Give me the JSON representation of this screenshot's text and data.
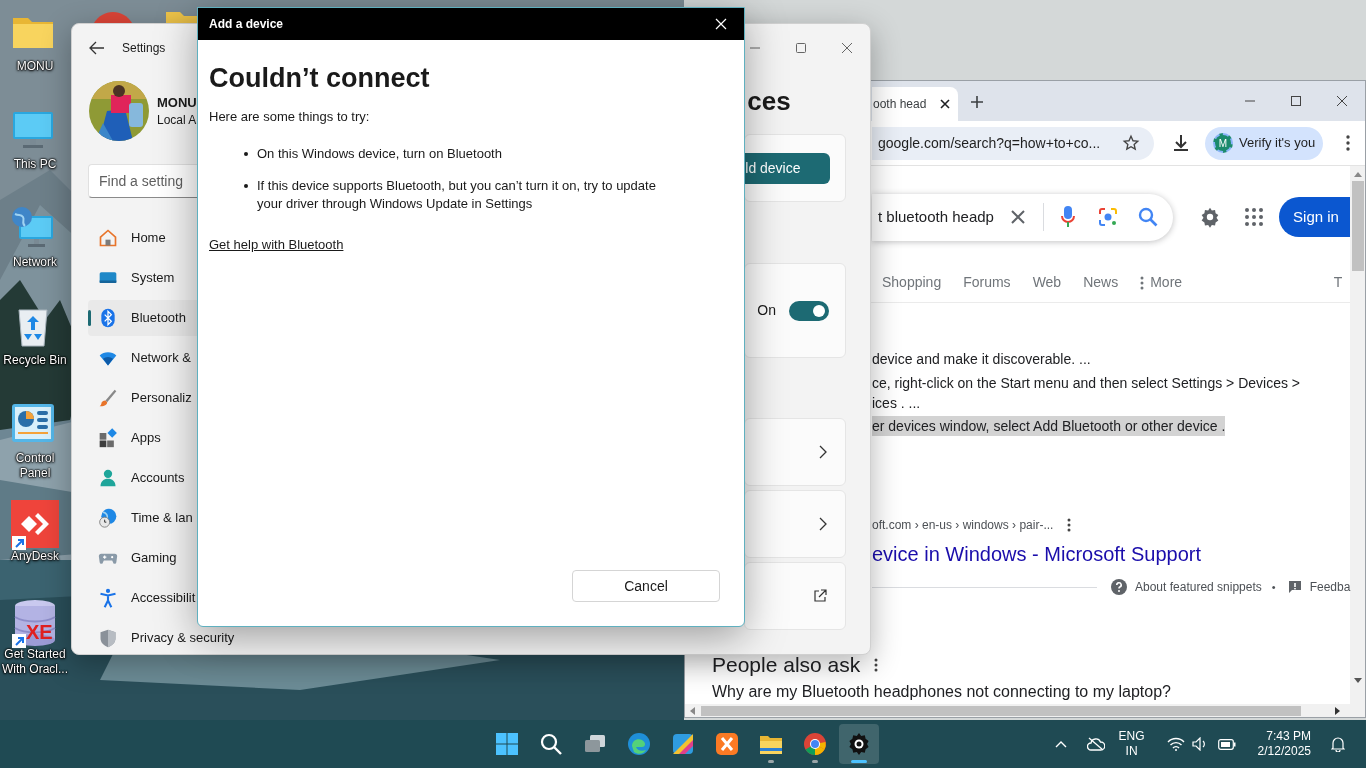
{
  "desktop_icons": [
    {
      "label": "MONU",
      "kind": "folder",
      "shortcut": false
    },
    {
      "label": "This PC",
      "kind": "pc",
      "shortcut": false
    },
    {
      "label": "Network",
      "kind": "network",
      "shortcut": false
    },
    {
      "label": "Recycle Bin",
      "kind": "recycle",
      "shortcut": false
    },
    {
      "label": "Control Panel",
      "kind": "control",
      "shortcut": false
    },
    {
      "label": "AnyDesk",
      "kind": "anydesk",
      "shortcut": true
    },
    {
      "label": "Get Started With Oracl...",
      "kind": "database",
      "shortcut": true,
      "badge": "XE"
    }
  ],
  "browser": {
    "tab_title": "ooth head",
    "address": "google.com/search?q=how+to+co...",
    "profile_button": "Verify it's you",
    "avatar_letter": "M",
    "search_query": "t bluetooth headp",
    "sign_in": "Sign in",
    "tabs": [
      {
        "label": "Shopping",
        "kind": "plain"
      },
      {
        "label": "Forums",
        "kind": "plain"
      },
      {
        "label": "Web",
        "kind": "plain"
      },
      {
        "label": "News",
        "kind": "plain"
      },
      {
        "label": "More",
        "kind": "menu"
      },
      {
        "label": "T",
        "kind": "edge"
      }
    ],
    "snippet_lines": [
      {
        "text": "device and make it discoverable. ...",
        "highlighted": false
      },
      {
        "text": "ce, right-click on the Start menu and then select Settings > Devices >",
        "highlighted": false
      },
      {
        "text": "ices . ...",
        "highlighted": false
      },
      {
        "text": "er devices window, select Add Bluetooth or other device .",
        "highlighted": true
      }
    ],
    "source": "oft.com › en-us › windows › pair-...",
    "result_title": "evice in Windows - Microsoft Support",
    "about_snippets": "About featured snippets",
    "separator": "•",
    "feedback": "Feedba",
    "people_also_ask": "People also ask",
    "question": "Why are my Bluetooth headphones not connecting to my laptop?"
  },
  "settings": {
    "title": "Settings",
    "user_name": "MONU",
    "account_type": "Local A",
    "search_placeholder": "Find a setting",
    "nav": [
      {
        "label": "Home",
        "kind": "home",
        "selected": false
      },
      {
        "label": "System",
        "kind": "system",
        "selected": false
      },
      {
        "label": "Bluetooth",
        "kind": "bluetooth",
        "selected": true
      },
      {
        "label": "Network &",
        "kind": "network",
        "selected": false
      },
      {
        "label": "Personaliz",
        "kind": "brush",
        "selected": false
      },
      {
        "label": "Apps",
        "kind": "apps",
        "selected": false
      },
      {
        "label": "Accounts",
        "kind": "accounts",
        "selected": false
      },
      {
        "label": "Time & lan",
        "kind": "time",
        "selected": false
      },
      {
        "label": "Gaming",
        "kind": "gaming",
        "selected": false
      },
      {
        "label": "Accessibilit",
        "kind": "accessibility",
        "selected": false
      },
      {
        "label": "Privacy & security",
        "kind": "privacy",
        "selected": false
      }
    ],
    "heading": "ces",
    "add_button": "ld device",
    "toggle_label": "On",
    "toggle_on": true,
    "cards": [
      {
        "kind": "chevron"
      },
      {
        "kind": "chevron"
      },
      {
        "kind": "external"
      }
    ]
  },
  "dialog": {
    "title": "Add a device",
    "heading": "Couldn’t connect",
    "intro": "Here are some things to try:",
    "tips": [
      "On this Windows device, turn on Bluetooth",
      "If this device supports Bluetooth, but you can’t turn it on, try to update your driver through Windows Update in Settings"
    ],
    "link": "Get help with Bluetooth",
    "cancel": "Cancel"
  },
  "taskbar": {
    "apps": [
      {
        "kind": "start",
        "running": false,
        "selected": false
      },
      {
        "kind": "search",
        "running": false,
        "selected": false
      },
      {
        "kind": "taskview",
        "running": false,
        "selected": false
      },
      {
        "kind": "edge",
        "running": false,
        "selected": false
      },
      {
        "kind": "copilot",
        "running": false,
        "selected": false
      },
      {
        "kind": "xampp",
        "running": false,
        "selected": false
      },
      {
        "kind": "explorer",
        "running": true,
        "selected": false
      },
      {
        "kind": "chrome",
        "running": true,
        "selected": false
      },
      {
        "kind": "settings",
        "running": true,
        "selected": true
      }
    ],
    "language": "ENG",
    "region": "IN",
    "time": "7:43 PM",
    "date": "2/12/2025"
  }
}
